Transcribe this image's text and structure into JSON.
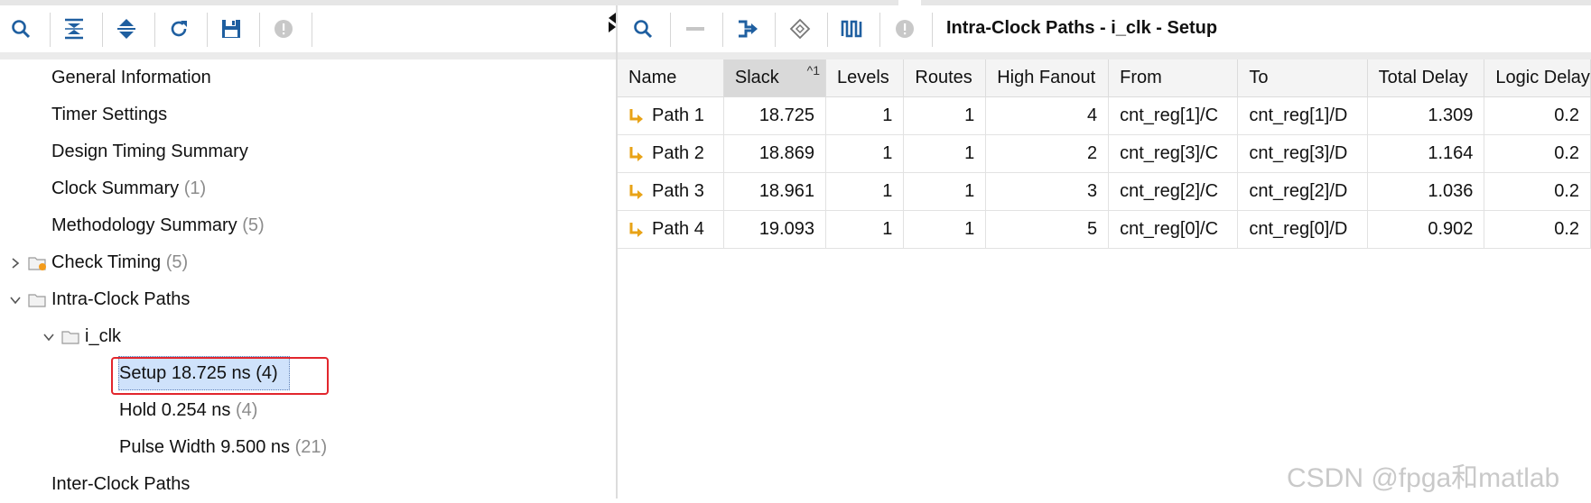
{
  "left_toolbar": {
    "icons": [
      "search-icon",
      "collapse-all-icon",
      "expand-all-icon",
      "refresh-icon",
      "save-icon",
      "info-icon"
    ]
  },
  "tree": {
    "items": [
      {
        "label": "General Information",
        "count": ""
      },
      {
        "label": "Timer Settings",
        "count": ""
      },
      {
        "label": "Design Timing Summary",
        "count": ""
      },
      {
        "label": "Clock Summary",
        "count": "(1)"
      },
      {
        "label": "Methodology Summary",
        "count": "(5)"
      },
      {
        "label": "Check Timing",
        "count": "(5)"
      },
      {
        "label": "Intra-Clock Paths",
        "count": ""
      },
      {
        "label": "i_clk",
        "count": ""
      },
      {
        "label": "Setup 18.725 ns",
        "count": "(4)"
      },
      {
        "label": "Hold 0.254 ns",
        "count": "(4)"
      },
      {
        "label": "Pulse Width 9.500 ns",
        "count": "(21)"
      },
      {
        "label": "Inter-Clock Paths",
        "count": ""
      }
    ]
  },
  "right_toolbar": {
    "icons": [
      "search-icon",
      "minus-icon",
      "schematic-icon",
      "diamond-icon",
      "waveform-icon",
      "info-icon"
    ],
    "title": "Intra-Clock Paths - i_clk - Setup"
  },
  "table": {
    "columns": [
      "Name",
      "Slack",
      "Levels",
      "Routes",
      "High Fanout",
      "From",
      "To",
      "Total Delay",
      "Logic Delay"
    ],
    "sort_indicator": "^1",
    "rows": [
      {
        "name": "Path 1",
        "slack": "18.725",
        "levels": "1",
        "routes": "1",
        "fanout": "4",
        "from": "cnt_reg[1]/C",
        "to": "cnt_reg[1]/D",
        "total": "1.309",
        "logic": "0.2"
      },
      {
        "name": "Path 2",
        "slack": "18.869",
        "levels": "1",
        "routes": "1",
        "fanout": "2",
        "from": "cnt_reg[3]/C",
        "to": "cnt_reg[3]/D",
        "total": "1.164",
        "logic": "0.2"
      },
      {
        "name": "Path 3",
        "slack": "18.961",
        "levels": "1",
        "routes": "1",
        "fanout": "3",
        "from": "cnt_reg[2]/C",
        "to": "cnt_reg[2]/D",
        "total": "1.036",
        "logic": "0.2"
      },
      {
        "name": "Path 4",
        "slack": "19.093",
        "levels": "1",
        "routes": "1",
        "fanout": "5",
        "from": "cnt_reg[0]/C",
        "to": "cnt_reg[0]/D",
        "total": "0.902",
        "logic": "0.2"
      }
    ]
  },
  "watermark": "CSDN @fpga和matlab",
  "colors": {
    "accent_blue": "#1f5fa0",
    "path_icon": "#e8a317",
    "selection": "#cfe2fb",
    "highlight_box": "#e2262d",
    "warning_dot": "#f39b1a"
  }
}
